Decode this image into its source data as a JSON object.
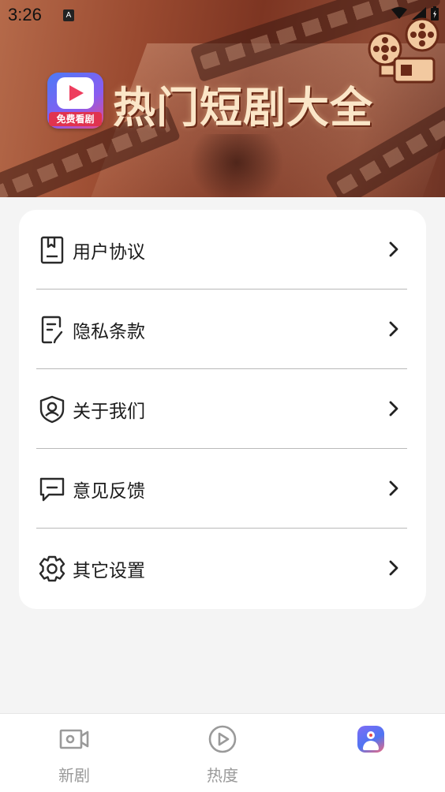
{
  "status_bar": {
    "time": "3:26",
    "notification_letter": "A"
  },
  "banner": {
    "logo_badge": "免费看剧",
    "title": "热门短剧大全"
  },
  "menu": {
    "items": [
      {
        "label": "用户协议",
        "icon": "document-icon"
      },
      {
        "label": "隐私条款",
        "icon": "privacy-doc-icon"
      },
      {
        "label": "关于我们",
        "icon": "shield-user-icon"
      },
      {
        "label": "意见反馈",
        "icon": "message-icon"
      },
      {
        "label": "其它设置",
        "icon": "gear-icon"
      }
    ]
  },
  "bottom_nav": {
    "items": [
      {
        "label": "新剧",
        "icon": "video-camera-icon",
        "active": false
      },
      {
        "label": "热度",
        "icon": "play-circle-icon",
        "active": false
      },
      {
        "label": "",
        "icon": "profile-icon",
        "active": true
      }
    ]
  },
  "colors": {
    "banner": "#8a3d28",
    "title": "#fbe6c8",
    "accent": "#e0334f"
  }
}
